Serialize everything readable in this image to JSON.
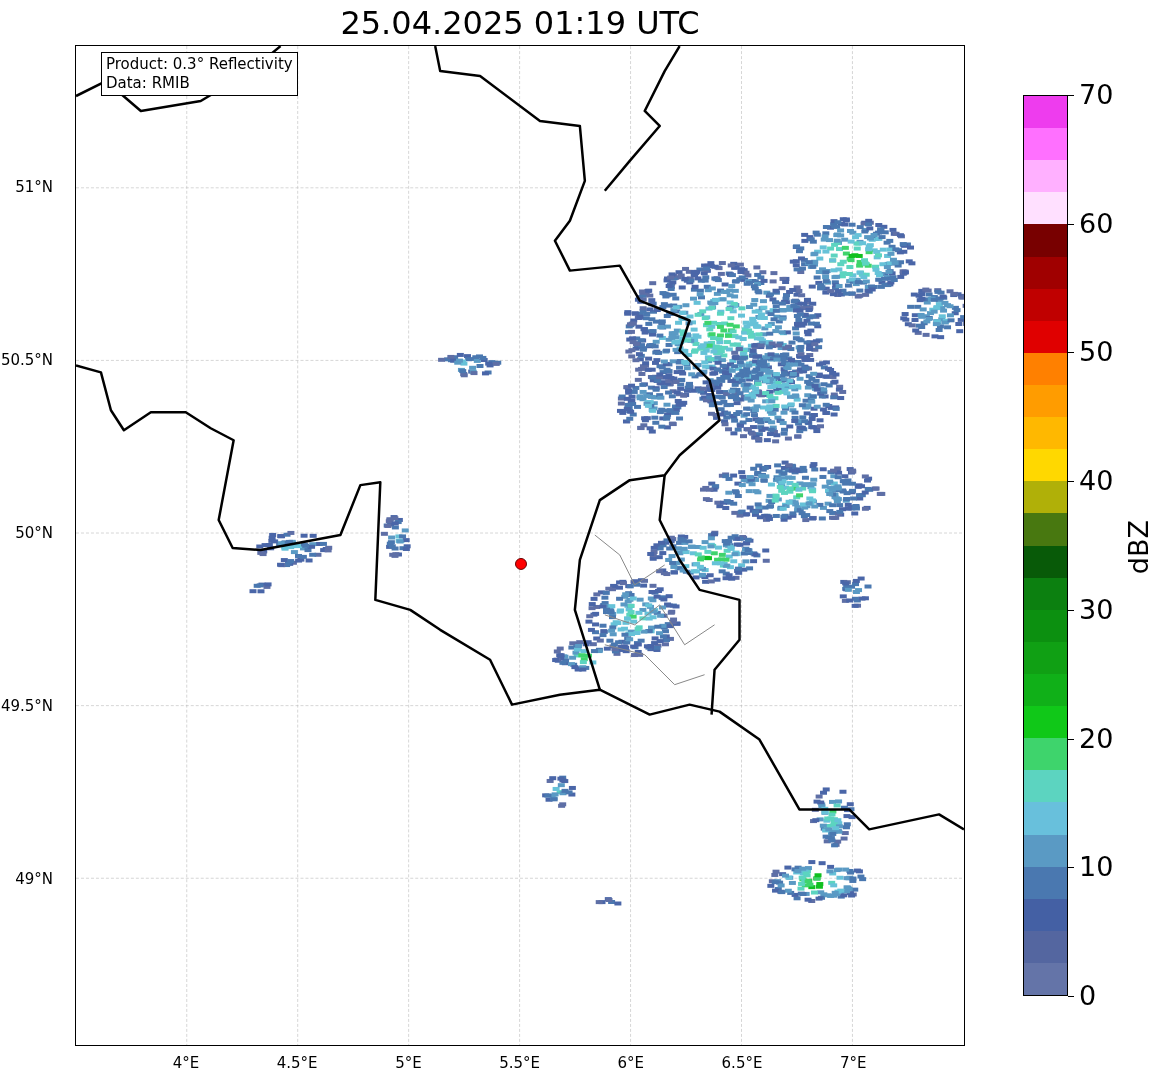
{
  "title": "25.04.2025 01:19 UTC",
  "map": {
    "info_box": [
      "Product: 0.3° Reflectivity",
      "Data: RMIB"
    ],
    "lat_labels": [
      "51°N",
      "50.5°N",
      "50°N",
      "49.5°N",
      "49°N"
    ],
    "lon_labels": [
      "4°E",
      "4.5°E",
      "5°E",
      "5.5°E",
      "6°E",
      "6.5°E",
      "7°E"
    ]
  },
  "colorbar": {
    "label": "dBZ",
    "ticks": [
      "70",
      "60",
      "50",
      "40",
      "30",
      "20",
      "10",
      "0"
    ]
  }
}
